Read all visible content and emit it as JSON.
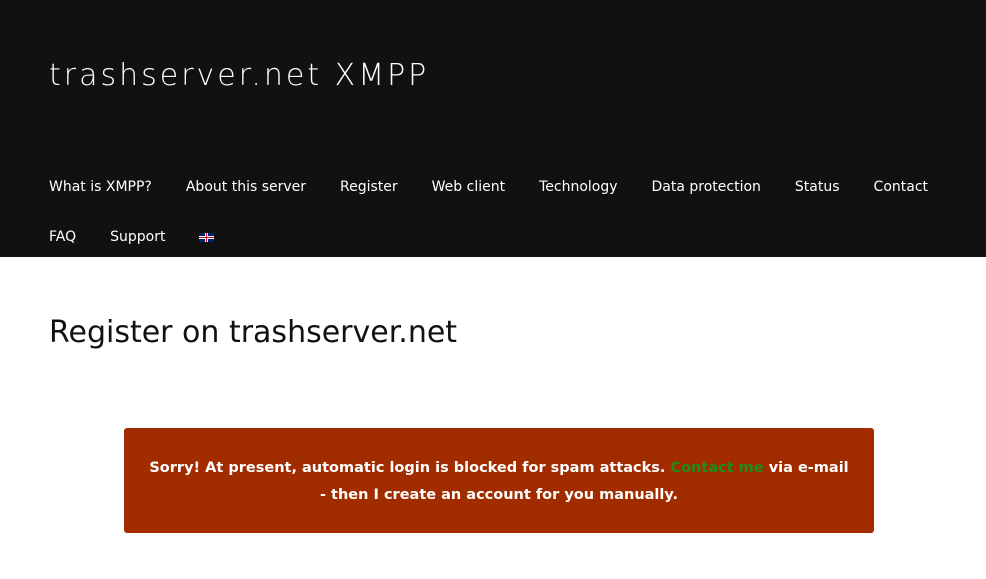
{
  "site": {
    "title": "trashserver.net XMPP"
  },
  "nav": {
    "items": [
      {
        "label": "What is XMPP?"
      },
      {
        "label": "About this server"
      },
      {
        "label": "Register"
      },
      {
        "label": "Web client"
      },
      {
        "label": "Technology"
      },
      {
        "label": "Data protection"
      },
      {
        "label": "Status"
      },
      {
        "label": "Contact"
      },
      {
        "label": "FAQ"
      },
      {
        "label": "Support"
      }
    ],
    "language_icon": "uk-flag-icon"
  },
  "page": {
    "title": "Register on trashserver.net"
  },
  "notice": {
    "text_before": "Sorry! At present, automatic login is blocked for spam attacks. ",
    "link": "Contact me",
    "text_after": " via e-mail - then I create an account for you manually."
  },
  "colors": {
    "header_bg": "#111111",
    "notice_bg": "#a12c00",
    "link": "#1e8c1e"
  }
}
